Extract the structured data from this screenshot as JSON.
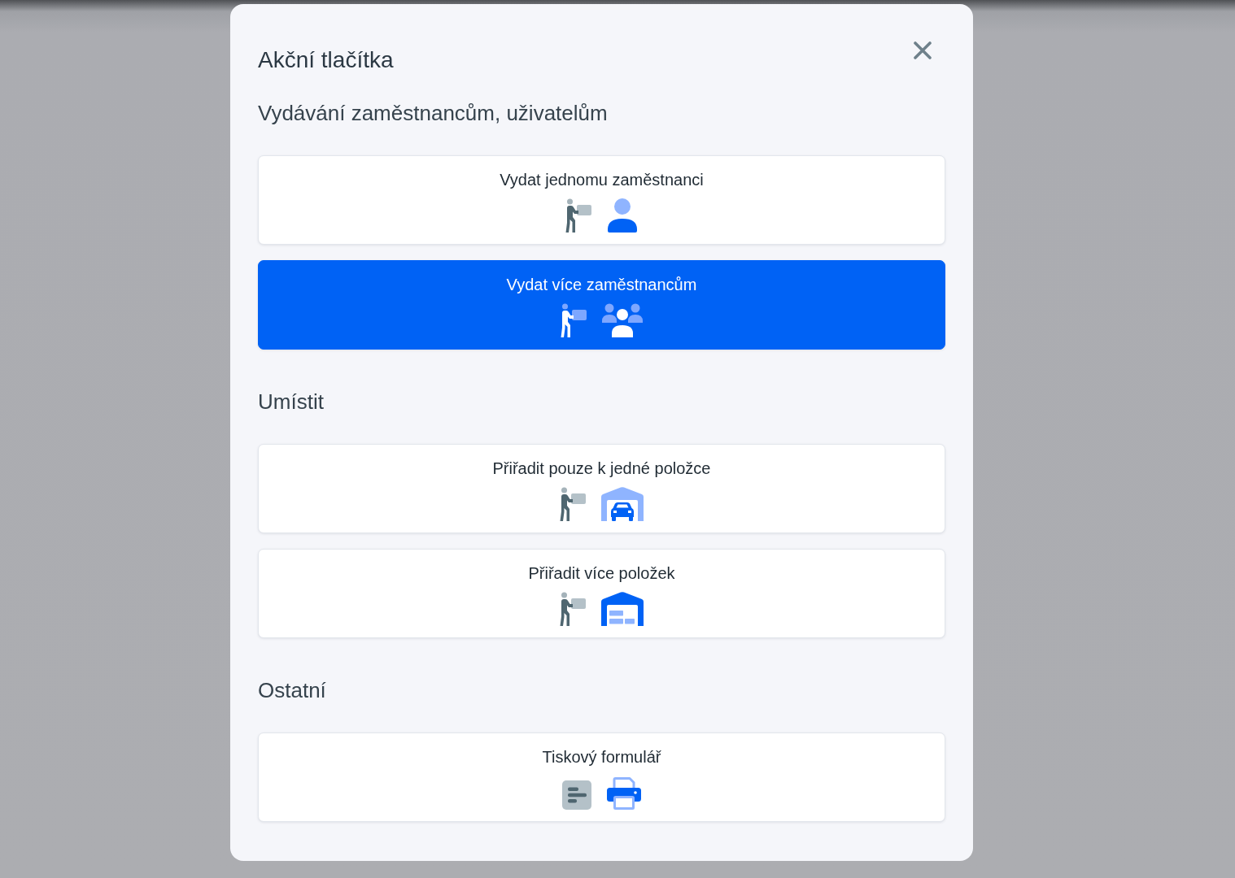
{
  "dialog": {
    "title": "Akční tlačítka",
    "sections": [
      {
        "heading": "Vydávání zaměstnancům, uživatelům",
        "actions": [
          {
            "label": "Vydat jednomu zaměstnanci",
            "kind": "employee",
            "selected": false
          },
          {
            "label": "Vydat více zaměstnancům",
            "kind": "employees",
            "selected": true
          }
        ]
      },
      {
        "heading": "Umístit",
        "actions": [
          {
            "label": "Přiřadit pouze k jedné položce",
            "kind": "garage",
            "selected": false
          },
          {
            "label": "Přiřadit více položek",
            "kind": "warehouse",
            "selected": false
          }
        ]
      },
      {
        "heading": "Ostatní",
        "actions": [
          {
            "label": "Tiskový formulář",
            "kind": "print",
            "selected": false
          }
        ]
      }
    ]
  }
}
